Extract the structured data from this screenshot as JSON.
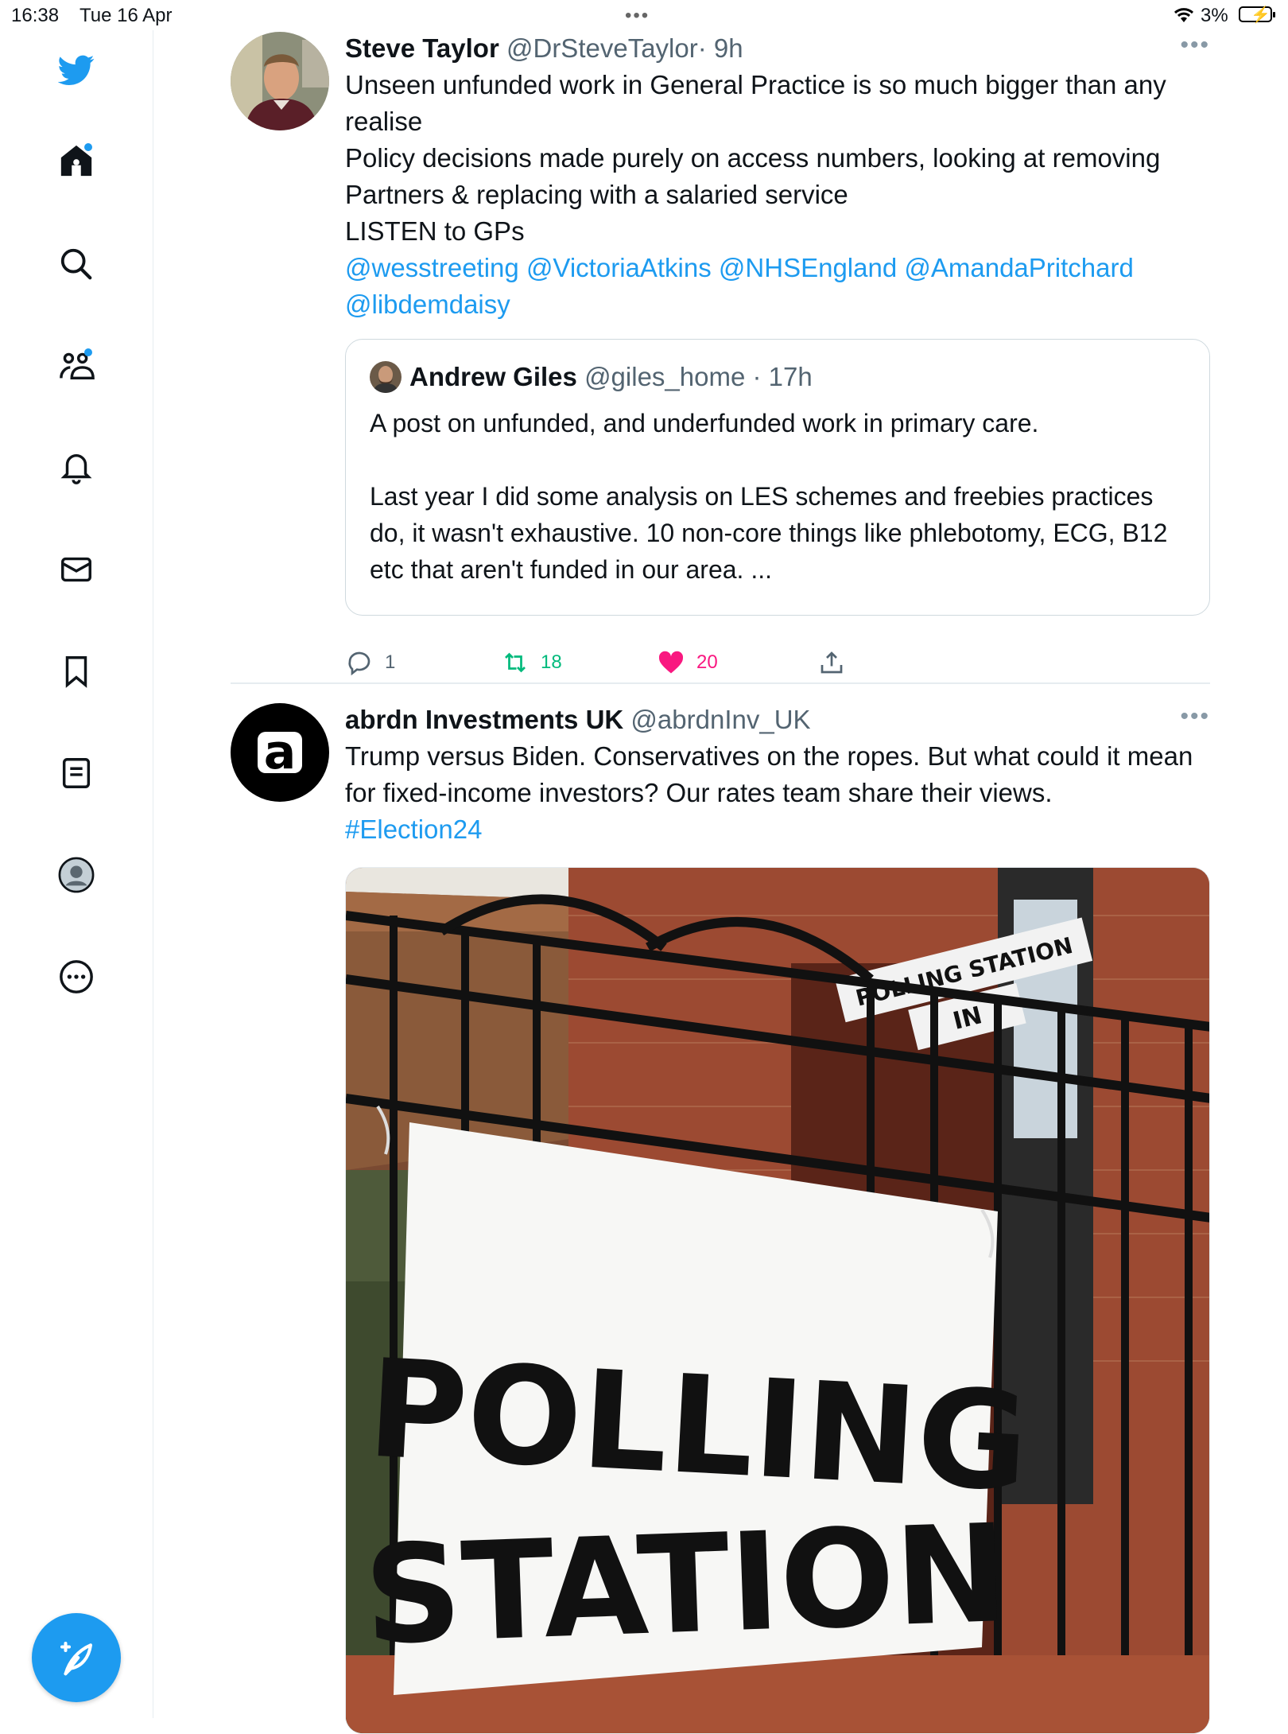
{
  "status_bar": {
    "time": "16:38",
    "date": "Tue 16 Apr",
    "handle_dots": "•••",
    "battery": "3%"
  },
  "sidebar": {
    "items": [
      {
        "icon": "twitter-bird-icon"
      },
      {
        "icon": "home-icon",
        "badge": true
      },
      {
        "icon": "search-icon"
      },
      {
        "icon": "communities-icon",
        "badge": true
      },
      {
        "icon": "notifications-bell-icon"
      },
      {
        "icon": "messages-envelope-icon"
      },
      {
        "icon": "bookmark-icon"
      },
      {
        "icon": "lists-icon"
      },
      {
        "icon": "profile-avatar-icon"
      },
      {
        "icon": "more-options-icon"
      }
    ],
    "compose_icon": "compose-feather-icon"
  },
  "colors": {
    "accent": "#1d9bf0",
    "like": "#f91880",
    "retweet": "#00ba7c"
  },
  "tweets": [
    {
      "name": "Steve Taylor",
      "handle": "@DrSteveTaylor",
      "time": "· 9h",
      "more": "•••",
      "lines": [
        "Unseen unfunded work in General Practice is so much bigger than any realise",
        "Policy decisions made purely on access numbers, looking at removing Partners & replacing with a salaried service",
        "LISTEN to GPs"
      ],
      "mentions": [
        "@wesstreeting",
        "@VictoriaAtkins",
        "@NHSEngland",
        "@AmandaPritchard",
        "@libdemdaisy"
      ],
      "quote": {
        "name": "Andrew Giles",
        "handle": "@giles_home",
        "time": "· 17h",
        "para1": "A post on unfunded, and underfunded work in primary care.",
        "para2": "Last year I did some analysis on LES schemes and freebies practices do, it wasn't exhaustive. 10 non-core things like phlebotomy, ECG, B12 etc that aren't funded in our area. ..."
      },
      "replies": "1",
      "retweets": "18",
      "likes": "20"
    },
    {
      "name": "abrdn Investments UK",
      "handle": "@abrdnInv_UK",
      "more": "•••",
      "text": "Trump versus Biden. Conservatives on the ropes. But what could it mean for fixed-income investors? Our rates team share their views.",
      "hashtag": "#Election24",
      "avatar_letter": "a",
      "image": {
        "sign_line1": "POLLING",
        "sign_line2": "STATION",
        "background_sign1": "POLLING STATION",
        "background_sign2": "IN"
      }
    }
  ]
}
